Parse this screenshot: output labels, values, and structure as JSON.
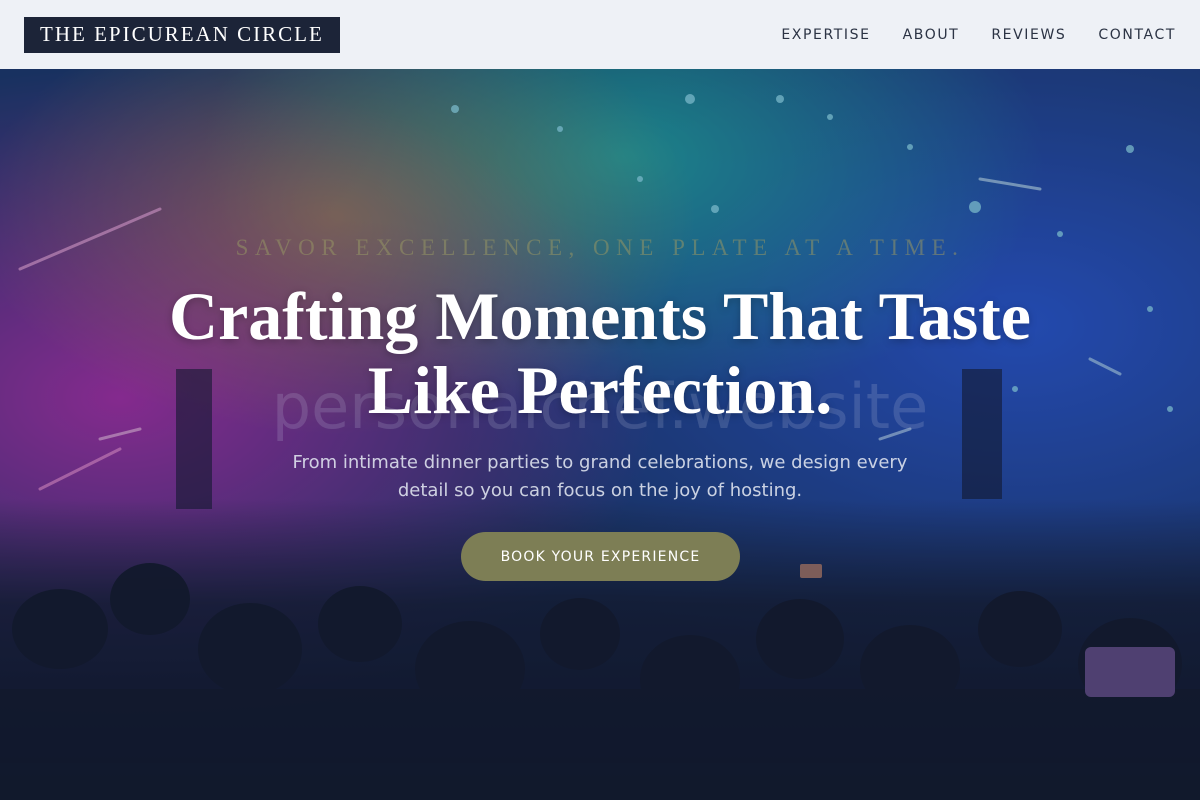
{
  "header": {
    "logo": "THE EPICUREAN CIRCLE",
    "nav": [
      {
        "label": "EXPERTISE"
      },
      {
        "label": "ABOUT"
      },
      {
        "label": "REVIEWS"
      },
      {
        "label": "CONTACT"
      }
    ]
  },
  "hero": {
    "tagline": "SAVOR EXCELLENCE, ONE PLATE AT A TIME.",
    "headline_line1": "Crafting Moments That Taste",
    "headline_line2": "Like Perfection.",
    "watermark": "personalchef.website",
    "subtitle": "From intimate dinner parties to grand celebrations, we design every detail so you can focus on the joy of hosting.",
    "cta_label": "BOOK YOUR EXPERIENCE"
  },
  "colors": {
    "header_bg": "#eef1f6",
    "logo_bg": "#1c2438",
    "cta_bg": "#7d7e55"
  }
}
